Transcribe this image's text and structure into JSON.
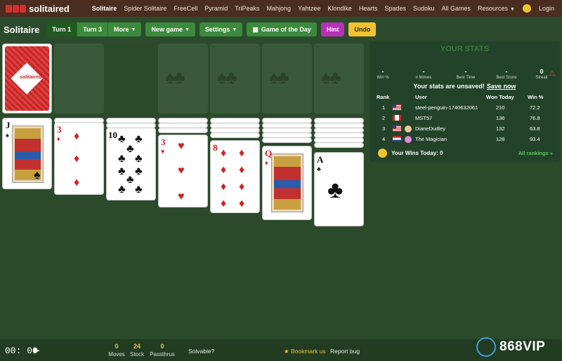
{
  "nav": {
    "brand": "solitaired",
    "links": [
      "Solitaire",
      "Spider Solitaire",
      "FreeCell",
      "Pyramid",
      "TriPeaks",
      "Mahjong",
      "Yahtzee",
      "Klondike",
      "Hearts",
      "Spades",
      "Sudoku",
      "All Games",
      "Resources"
    ],
    "login": "Login"
  },
  "toolbar": {
    "title": "Solitaire",
    "turn1": "Turn 1",
    "turn3": "Turn 3",
    "more": "More",
    "new_game": "New game",
    "settings": "Settings",
    "game_of_day": "Game of the Day",
    "hint": "Hint",
    "undo": "Undo"
  },
  "stock": {
    "label": "solitaired"
  },
  "tableau": [
    {
      "rank": "J",
      "suit": "♠",
      "color": "black"
    },
    {
      "rank": "3",
      "suit": "♦",
      "color": "red"
    },
    {
      "rank": "10",
      "suit": "♣",
      "color": "black"
    },
    {
      "rank": "3",
      "suit": "♥",
      "color": "red"
    },
    {
      "rank": "8",
      "suit": "♦",
      "color": "red"
    },
    {
      "rank": "Q",
      "suit": "♦",
      "color": "red"
    },
    {
      "rank": "A",
      "suit": "♣",
      "color": "black"
    }
  ],
  "stats": {
    "title": "YOUR STATS",
    "win_pct": {
      "value": "-",
      "label": "Win %"
    },
    "moves": {
      "value": "-",
      "label": "# Moves"
    },
    "best_time": {
      "value": "-",
      "label": "Best Time"
    },
    "best_score": {
      "value": "-",
      "label": "Best Score"
    },
    "streak": {
      "value": "0",
      "label": "Streak"
    },
    "unsaved_text": "Your stats are unsaved!",
    "save_now": "Save now",
    "headers": {
      "rank": "Rank",
      "user": "User",
      "won_today": "Won Today",
      "win_pct": "Win %"
    },
    "rows": [
      {
        "rank": "1",
        "user": "steel-penguin-1740632061",
        "won": "210",
        "pct": "72.2"
      },
      {
        "rank": "2",
        "user": "MST57",
        "won": "136",
        "pct": "76.8"
      },
      {
        "rank": "3",
        "user": "DianeDudley",
        "won": "132",
        "pct": "63.8"
      },
      {
        "rank": "4",
        "user": "The Magician",
        "won": "128",
        "pct": "93.4"
      }
    ],
    "wins_today": "Your Wins Today: 0",
    "all_rankings": "All rankings »"
  },
  "footer": {
    "timer": "00: 00",
    "moves_value": "0",
    "moves_label": "Moves",
    "stock_value": "24",
    "stock_label": "Stock",
    "passthrus_value": "0",
    "passthrus_label": "Passthrus",
    "solvable": "Solvable?",
    "bookmark": "★ Bookmark us",
    "report": "Report bug"
  },
  "watermark": "868VIP"
}
